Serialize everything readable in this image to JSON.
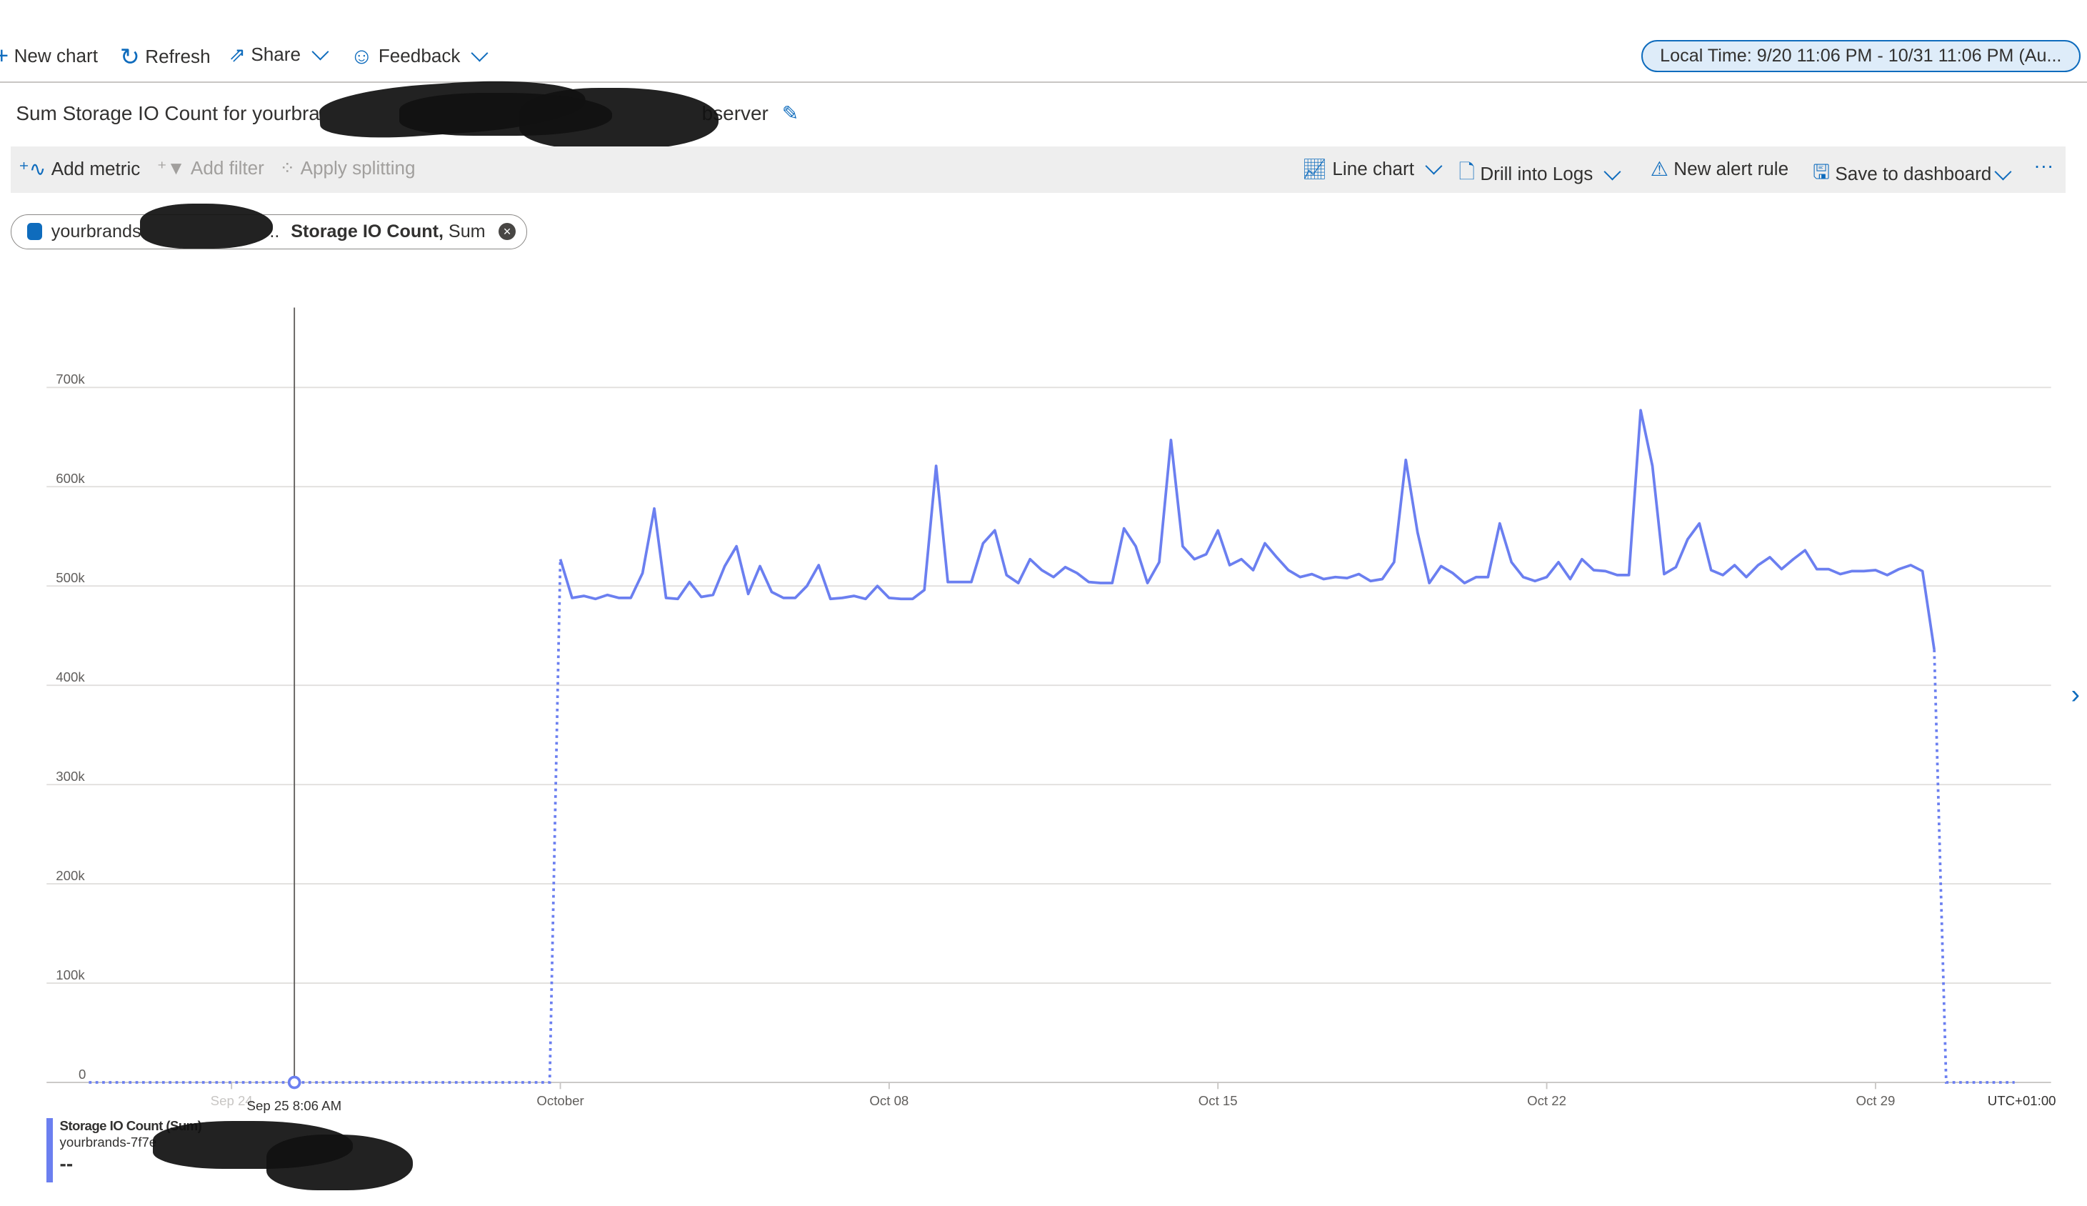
{
  "toolbar": {
    "new_chart": "New chart",
    "refresh": "Refresh",
    "share": "Share",
    "feedback": "Feedback",
    "time_range": "Local Time: 9/20 11:06 PM - 10/31 11:06 PM (Au..."
  },
  "chart_title": {
    "prefix": "Sum Storage IO Count for yourbra",
    "suffix": "bserver"
  },
  "metric_toolbar": {
    "add_metric": "Add metric",
    "add_filter": "Add filter",
    "apply_splitting": "Apply splitting",
    "line_chart": "Line chart",
    "drill_into_logs": "Drill into Logs",
    "new_alert_rule": "New alert rule",
    "save_to_dashboard": "Save to dashboard",
    "more": "···"
  },
  "metric_pill": {
    "resource": "yourbrands",
    "ellipsis": "..",
    "metric": "Storage IO Count,",
    "aggregation": " Sum"
  },
  "legend": {
    "name": "Storage IO Count (Sum)",
    "resource": "yourbrands-7f7e",
    "value": "--"
  },
  "colors": {
    "accent": "#0f6cbd",
    "series": "#6b7ff0",
    "toolbar_bg": "#eeeeee",
    "pill_bg": "#deecf9"
  },
  "chart_data": {
    "type": "line",
    "time_range": [
      "Sep 20 23:06",
      "Oct 31 23:06"
    ],
    "timezone_label": "UTC+01:00",
    "cursor_label": "Sep 25 8:06 AM",
    "cursor_time": "Sep 25 08:06",
    "ylim": [
      0,
      700000
    ],
    "y_ticks": [
      {
        "v": 0,
        "label": "0"
      },
      {
        "v": 100000,
        "label": "100k"
      },
      {
        "v": 200000,
        "label": "200k"
      },
      {
        "v": 300000,
        "label": "300k"
      },
      {
        "v": 400000,
        "label": "400k"
      },
      {
        "v": 500000,
        "label": "500k"
      },
      {
        "v": 600000,
        "label": "600k"
      },
      {
        "v": 700000,
        "label": "700k"
      }
    ],
    "x_ticks": [
      {
        "t": "Sep 24",
        "label": "Sep 24",
        "faded": true
      },
      {
        "t": "Oct 01",
        "label": "October"
      },
      {
        "t": "Oct 08",
        "label": "Oct 08"
      },
      {
        "t": "Oct 15",
        "label": "Oct 15"
      },
      {
        "t": "Oct 22",
        "label": "Oct 22"
      },
      {
        "t": "Oct 29",
        "label": "Oct 29"
      }
    ],
    "grid": true,
    "interval_hours": 6,
    "no_data_shown_as_dotted_zero": true,
    "series": [
      {
        "name": "Storage IO Count (Sum)",
        "days": [
          {
            "date": "Oct 01",
            "values": [
              527000,
              488000,
              490000,
              487000
            ]
          },
          {
            "date": "Oct 02",
            "values": [
              491000,
              488000,
              488000,
              513000
            ]
          },
          {
            "date": "Oct 03",
            "values": [
              578000,
              488000,
              487000,
              504000
            ]
          },
          {
            "date": "Oct 04",
            "values": [
              489000,
              491000,
              520000,
              540000
            ]
          },
          {
            "date": "Oct 05",
            "values": [
              492000,
              520000,
              494000,
              488000
            ]
          },
          {
            "date": "Oct 06",
            "values": [
              488000,
              500000,
              521000,
              487000
            ]
          },
          {
            "date": "Oct 07",
            "values": [
              488000,
              490000,
              487000,
              500000
            ]
          },
          {
            "date": "Oct 08",
            "values": [
              488000,
              487000,
              487000,
              496000
            ]
          },
          {
            "date": "Oct 09",
            "values": [
              621000,
              504000,
              504000,
              504000
            ]
          },
          {
            "date": "Oct 10",
            "values": [
              543000,
              556000,
              511000,
              503000
            ]
          },
          {
            "date": "Oct 11",
            "values": [
              527000,
              516000,
              509000,
              519000
            ]
          },
          {
            "date": "Oct 12",
            "values": [
              513000,
              504000,
              503000,
              503000
            ]
          },
          {
            "date": "Oct 13",
            "values": [
              558000,
              540000,
              503000,
              524000
            ]
          },
          {
            "date": "Oct 14",
            "values": [
              647000,
              540000,
              527000,
              532000
            ]
          },
          {
            "date": "Oct 15",
            "values": [
              556000,
              521000,
              527000,
              516000
            ]
          },
          {
            "date": "Oct 16",
            "values": [
              543000,
              529000,
              516000,
              509000
            ]
          },
          {
            "date": "Oct 17",
            "values": [
              512000,
              507000,
              509000,
              508000
            ]
          },
          {
            "date": "Oct 18",
            "values": [
              512000,
              505000,
              507000,
              524000
            ]
          },
          {
            "date": "Oct 19",
            "values": [
              627000,
              554000,
              503000,
              520000
            ]
          },
          {
            "date": "Oct 20",
            "values": [
              513000,
              503000,
              509000,
              509000
            ]
          },
          {
            "date": "Oct 21",
            "values": [
              563000,
              524000,
              509000,
              505000
            ]
          },
          {
            "date": "Oct 22",
            "values": [
              509000,
              524000,
              507000,
              527000
            ]
          },
          {
            "date": "Oct 23",
            "values": [
              516000,
              515000,
              511000,
              511000
            ]
          },
          {
            "date": "Oct 24",
            "values": [
              677000,
              621000,
              512000,
              519000
            ]
          },
          {
            "date": "Oct 25",
            "values": [
              547000,
              563000,
              516000,
              511000
            ]
          },
          {
            "date": "Oct 26",
            "values": [
              521000,
              509000,
              521000,
              529000
            ]
          },
          {
            "date": "Oct 27",
            "values": [
              517000,
              527000,
              536000,
              517000
            ]
          },
          {
            "date": "Oct 28",
            "values": [
              517000,
              512000,
              515000,
              515000
            ]
          },
          {
            "date": "Oct 29",
            "values": [
              516000,
              511000,
              517000,
              521000
            ]
          },
          {
            "date": "Oct 30",
            "values": [
              515000,
              436000
            ]
          }
        ]
      }
    ]
  }
}
